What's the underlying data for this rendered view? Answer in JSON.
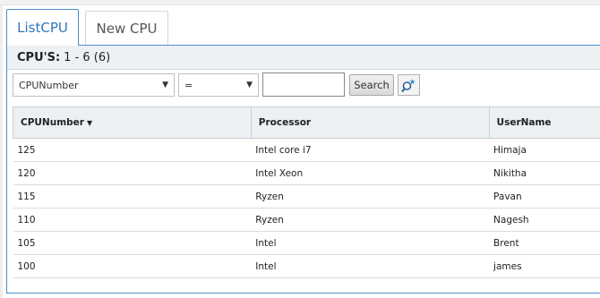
{
  "tabs": [
    {
      "label": "ListCPU",
      "active": true
    },
    {
      "label": "New CPU",
      "active": false
    }
  ],
  "header": {
    "title": "CPU'S:",
    "range": "1 - 6 (6)"
  },
  "filter": {
    "field_value": "CPUNumber",
    "operator_value": "=",
    "search_text": "",
    "search_label": "Search",
    "advanced_icon": "advanced-search-icon"
  },
  "table": {
    "columns": [
      "CPUNumber",
      "Processor",
      "UserName"
    ],
    "sort_indicator": "▼",
    "rows": [
      [
        "125",
        "Intel core i7",
        "Himaja"
      ],
      [
        "120",
        "Intel Xeon",
        "Nikitha"
      ],
      [
        "115",
        "Ryzen",
        "Pavan"
      ],
      [
        "110",
        "Ryzen",
        "Nagesh"
      ],
      [
        "105",
        "Intel",
        "Brent"
      ],
      [
        "100",
        "Intel",
        "james"
      ]
    ]
  },
  "colors": {
    "accent": "#4a8fcb",
    "tab_active_text": "#2e78b8"
  }
}
